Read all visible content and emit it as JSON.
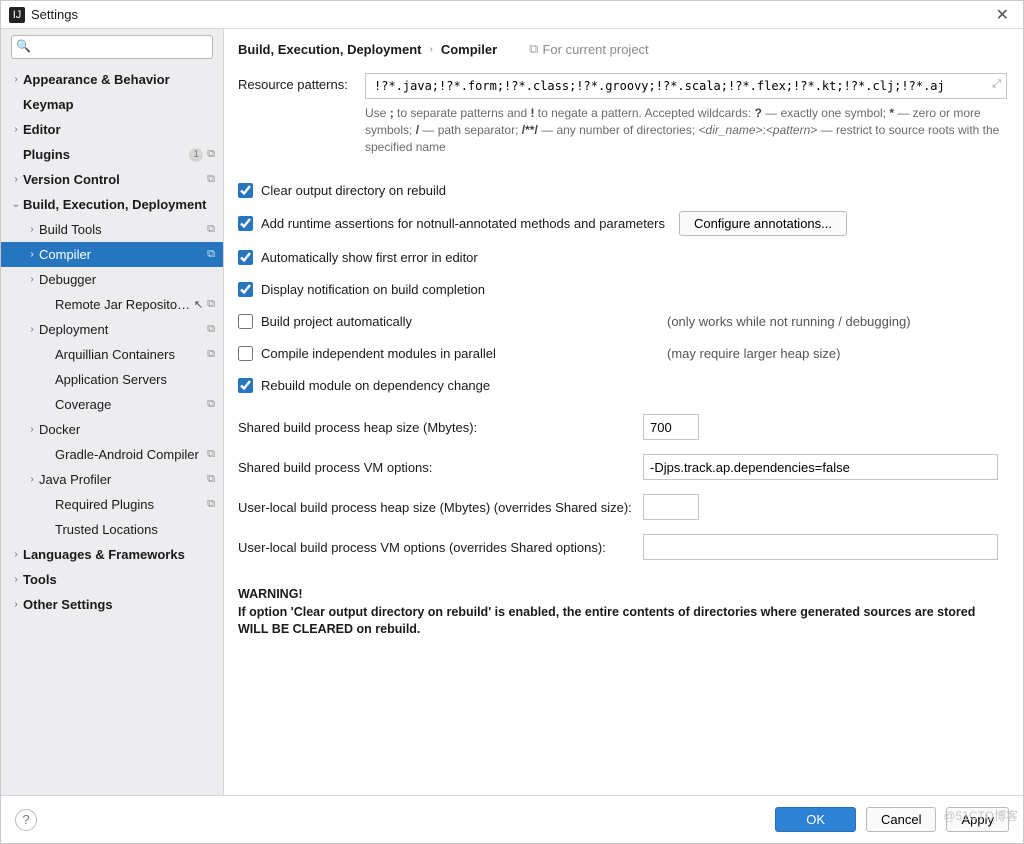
{
  "window": {
    "title": "Settings"
  },
  "search": {
    "placeholder": ""
  },
  "sidebar": {
    "items": [
      {
        "label": "Appearance & Behavior",
        "level": 0,
        "chev": "›",
        "bold": true
      },
      {
        "label": "Keymap",
        "level": 0,
        "chev": "",
        "bold": true
      },
      {
        "label": "Editor",
        "level": 0,
        "chev": "›",
        "bold": true
      },
      {
        "label": "Plugins",
        "level": 0,
        "chev": "",
        "bold": true,
        "badge": "1",
        "copy": true
      },
      {
        "label": "Version Control",
        "level": 0,
        "chev": "›",
        "bold": true,
        "copy": true
      },
      {
        "label": "Build, Execution, Deployment",
        "level": 0,
        "chev": "⌄",
        "bold": true
      },
      {
        "label": "Build Tools",
        "level": 1,
        "chev": "›",
        "copy": true
      },
      {
        "label": "Compiler",
        "level": 1,
        "chev": "›",
        "selected": true,
        "copy": true
      },
      {
        "label": "Debugger",
        "level": 1,
        "chev": "›"
      },
      {
        "label": "Remote Jar Repositories",
        "level": 2,
        "chev": "",
        "copy": true,
        "cursor": true
      },
      {
        "label": "Deployment",
        "level": 1,
        "chev": "›",
        "copy": true
      },
      {
        "label": "Arquillian Containers",
        "level": 2,
        "chev": "",
        "copy": true
      },
      {
        "label": "Application Servers",
        "level": 2,
        "chev": ""
      },
      {
        "label": "Coverage",
        "level": 2,
        "chev": "",
        "copy": true
      },
      {
        "label": "Docker",
        "level": 1,
        "chev": "›"
      },
      {
        "label": "Gradle-Android Compiler",
        "level": 2,
        "chev": "",
        "copy": true
      },
      {
        "label": "Java Profiler",
        "level": 1,
        "chev": "›",
        "copy": true
      },
      {
        "label": "Required Plugins",
        "level": 2,
        "chev": "",
        "copy": true
      },
      {
        "label": "Trusted Locations",
        "level": 2,
        "chev": ""
      },
      {
        "label": "Languages & Frameworks",
        "level": 0,
        "chev": "›",
        "bold": true
      },
      {
        "label": "Tools",
        "level": 0,
        "chev": "›",
        "bold": true
      },
      {
        "label": "Other Settings",
        "level": 0,
        "chev": "›",
        "bold": true
      }
    ]
  },
  "breadcrumb": {
    "seg1": "Build, Execution, Deployment",
    "seg2": "Compiler",
    "scope": "For current project"
  },
  "form": {
    "resource_patterns_label": "Resource patterns:",
    "resource_patterns_value": "!?*.java;!?*.form;!?*.class;!?*.groovy;!?*.scala;!?*.flex;!?*.kt;!?*.clj;!?*.aj",
    "hint_html": "Use <b>;</b> to separate patterns and <b>!</b> to negate a pattern. Accepted wildcards: <b>?</b> — exactly one symbol; <b>*</b> — zero or more symbols; <b>/</b> — path separator; <b>/**/</b> — any number of directories; <i>&lt;dir_name&gt;</i>:<i>&lt;pattern&gt;</i> — restrict to source roots with the specified name",
    "chk_clear": "Clear output directory on rebuild",
    "chk_assert": "Add runtime assertions for notnull-annotated methods and parameters",
    "btn_configure": "Configure annotations...",
    "chk_first_error": "Automatically show first error in editor",
    "chk_notification": "Display notification on build completion",
    "chk_auto_build": "Build project automatically",
    "note_auto_build": "(only works while not running / debugging)",
    "chk_parallel": "Compile independent modules in parallel",
    "note_parallel": "(may require larger heap size)",
    "chk_rebuild": "Rebuild module on dependency change",
    "shared_heap_label": "Shared build process heap size (Mbytes):",
    "shared_heap_value": "700",
    "shared_vm_label": "Shared build process VM options:",
    "shared_vm_value": "-Djps.track.ap.dependencies=false",
    "user_heap_label": "User-local build process heap size (Mbytes) (overrides Shared size):",
    "user_heap_value": "",
    "user_vm_label": "User-local build process VM options (overrides Shared options):",
    "user_vm_value": "",
    "warning_title": "WARNING!",
    "warning_body": "If option 'Clear output directory on rebuild' is enabled, the entire contents of directories where generated sources are stored WILL BE CLEARED on rebuild."
  },
  "footer": {
    "ok": "OK",
    "cancel": "Cancel",
    "apply": "Apply"
  },
  "watermark": "@51CTO博客"
}
